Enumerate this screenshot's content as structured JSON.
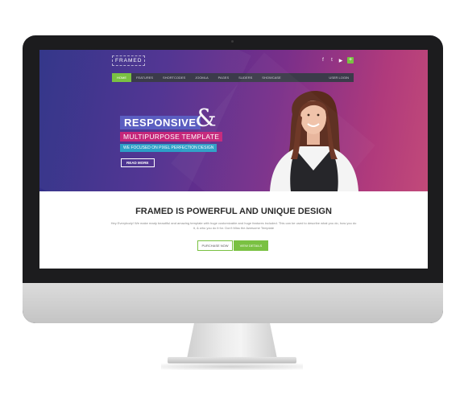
{
  "header": {
    "logo_text": "FRAMED",
    "social_icons": [
      "facebook-icon",
      "twitter-icon",
      "youtube-icon",
      "plus-icon"
    ],
    "social_glyphs": [
      "f",
      "t",
      "▶",
      "+"
    ]
  },
  "nav": {
    "items": [
      {
        "label": "HOME",
        "active": true
      },
      {
        "label": "FEATURES"
      },
      {
        "label": "SHORTCODES"
      },
      {
        "label": "JOOMLA"
      },
      {
        "label": "PAGES"
      },
      {
        "label": "SLIDERS"
      },
      {
        "label": "SHOWCASE"
      }
    ],
    "right_label": "USER LOGIN"
  },
  "hero": {
    "title": "RESPONSIVE",
    "ampersand": "&",
    "subtitle": "MULTIPURPOSE TEMPLATE",
    "tagline": "WE FOCUSED ON PIXEL PERFECTION DESIGN",
    "cta": "READ MORE"
  },
  "content": {
    "title": "FRAMED IS POWERFUL AND UNIQUE DESIGN",
    "body": "Hey Everybody! We make ready beautiful and amazing template with huge customizable and huge features included. This can be used to describe what you do, how you do it, & who you do it for. Don't Miss the Awesome Template",
    "buttons": {
      "purchase": "PURCHASE NOW",
      "details": "VIEW DETAILS"
    }
  },
  "colors": {
    "accent_green": "#7ac142",
    "hero_purple": "#4b2e8f",
    "hero_pink": "#c5267a",
    "badge_blue": "#2c9fc7",
    "badge_indigo": "#5b5ec1"
  }
}
